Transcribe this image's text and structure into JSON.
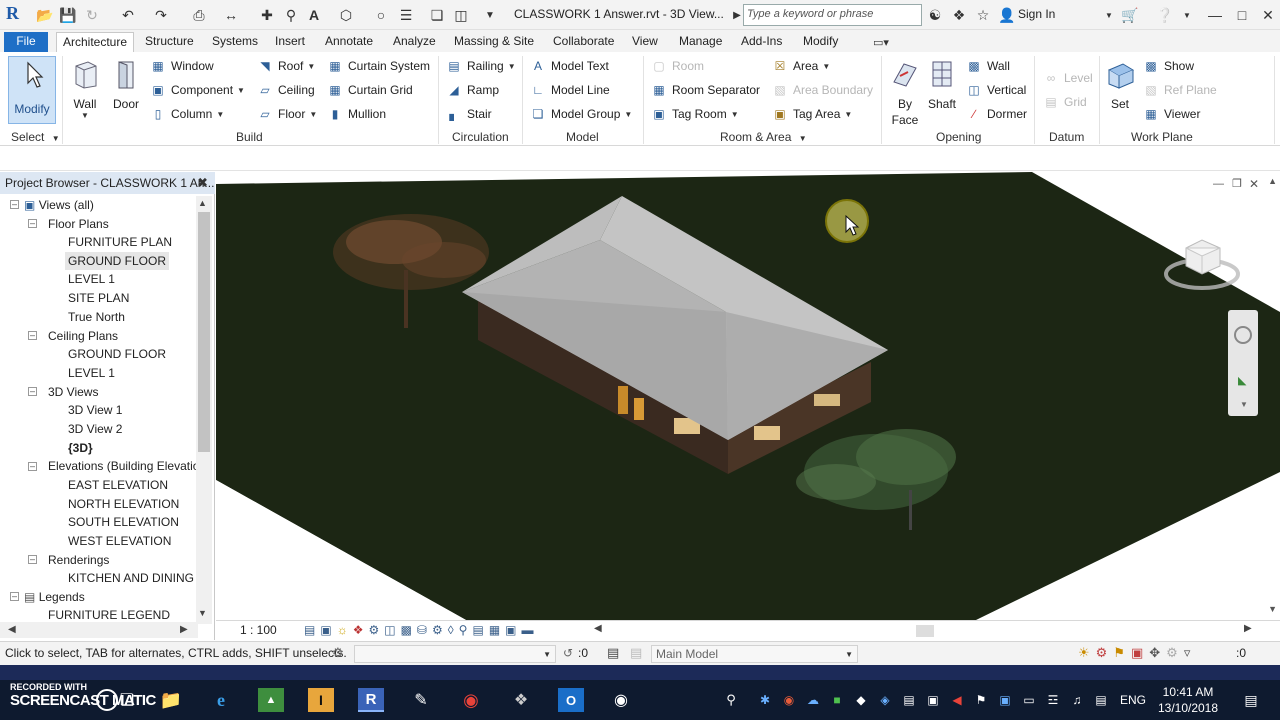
{
  "app": {
    "title": "CLASSWORK 1 Answer.rvt - 3D View...",
    "search_placeholder": "Type a keyword or phrase",
    "sign_in": "Sign In"
  },
  "tabs": [
    "File",
    "Architecture",
    "Structure",
    "Systems",
    "Insert",
    "Annotate",
    "Analyze",
    "Massing & Site",
    "Collaborate",
    "View",
    "Manage",
    "Add-Ins",
    "Modify"
  ],
  "active_tab": "Architecture",
  "ribbon": {
    "select": {
      "modify": "Modify",
      "select_label": "Select"
    },
    "build": {
      "label": "Build",
      "wall": "Wall",
      "door": "Door",
      "window": "Window",
      "component": "Component",
      "column": "Column",
      "roof": "Roof",
      "ceiling": "Ceiling",
      "floor": "Floor",
      "curtain_system": "Curtain  System",
      "curtain_grid": "Curtain  Grid",
      "mullion": "Mullion"
    },
    "circulation": {
      "label": "Circulation",
      "railing": "Railing",
      "ramp": "Ramp",
      "stair": "Stair"
    },
    "model": {
      "label": "Model",
      "model_text": "Model  Text",
      "model_line": "Model  Line",
      "model_group": "Model  Group"
    },
    "room_area": {
      "label": "Room & Area",
      "room": "Room",
      "room_separator": "Room  Separator",
      "tag_room": "Tag  Room",
      "area": "Area",
      "area_boundary": "Area  Boundary",
      "tag_area": "Tag  Area"
    },
    "opening": {
      "label": "Opening",
      "by_face_1": "By",
      "by_face_2": "Face",
      "shaft": "Shaft",
      "wall": "Wall",
      "vertical": "Vertical",
      "dormer": "Dormer"
    },
    "datum": {
      "label": "Datum",
      "level": "Level",
      "grid": "Grid"
    },
    "work_plane": {
      "label": "Work Plane",
      "set": "Set",
      "show": "Show",
      "ref_plane": "Ref  Plane",
      "viewer": "Viewer"
    }
  },
  "project_browser": {
    "title": "Project Browser - CLASSWORK 1 An...",
    "views_all": "Views (all)",
    "floor_plans": "Floor Plans",
    "floor_plan_items": [
      "FURNITURE PLAN",
      "GROUND FLOOR",
      "LEVEL 1",
      "SITE PLAN",
      "True North"
    ],
    "ceiling_plans": "Ceiling Plans",
    "ceiling_plan_items": [
      "GROUND FLOOR",
      "LEVEL 1"
    ],
    "views_3d": "3D Views",
    "views_3d_items": [
      "3D View 1",
      "3D View 2",
      "{3D}"
    ],
    "elevations": "Elevations (Building Elevatio",
    "elevation_items": [
      "EAST ELEVATION",
      "NORTH ELEVATION",
      "SOUTH ELEVATION",
      "WEST ELEVATION"
    ],
    "renderings": "Renderings",
    "rendering_items": [
      "KITCHEN AND DINING"
    ],
    "legends": "Legends",
    "legend_items": [
      "FURNITURE LEGEND"
    ]
  },
  "view_control": {
    "scale": "1 : 100"
  },
  "status": {
    "hint": "Click to select, TAB for alternates, CTRL adds, SHIFT unselects.",
    "workset_count": ":0",
    "model": "Main Model",
    "filter_count": ":0"
  },
  "taskbar": {
    "watermark_top": "RECORDED WITH",
    "watermark_bottom": "SCREENCAST  MATIC",
    "lang": "ENG",
    "time": "10:41 AM",
    "date": "13/10/2018"
  }
}
